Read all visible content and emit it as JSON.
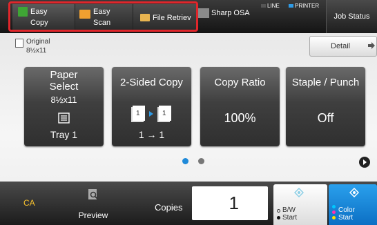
{
  "tabs": {
    "easy_copy": "Easy Copy",
    "easy_copy_l1": "Easy",
    "easy_copy_l2": "Copy",
    "easy_scan_l1": "Easy",
    "easy_scan_l2": "Scan",
    "file_retrieve": "File Retriev"
  },
  "header": {
    "sharp_osa": "Sharp OSA",
    "line_status": "LINE",
    "printer_status": "PRINTER",
    "job_status": "Job Status"
  },
  "original": {
    "label": "Original",
    "size": "8½x11"
  },
  "detail_button": "Detail",
  "cards": [
    {
      "title_l1": "Paper",
      "title_l2": "Select",
      "size": "8½x11",
      "value": "Tray 1"
    },
    {
      "title": "2-Sided Copy",
      "value": "1 → 1"
    },
    {
      "title": "Copy Ratio",
      "value": "100%"
    },
    {
      "title": "Staple / Punch",
      "value": "Off"
    }
  ],
  "pager": {
    "current_page": 1,
    "total_pages": 2
  },
  "bottom": {
    "ca": "CA",
    "preview": "Preview",
    "copies_label": "Copies",
    "copies_value": "1",
    "bw_l1": "B/W",
    "bw_l2": "Start",
    "color_l1": "Color",
    "color_l2": "Start"
  },
  "colors": {
    "accent_blue": "#1f8ad9",
    "highlight_red": "#e0262b",
    "ca_yellow": "#f7c12e",
    "easy_copy_icon": "#3fa535",
    "easy_scan_icon": "#f0a030",
    "line_indicator": "#555555",
    "printer_indicator": "#2f9be6"
  },
  "icons": {
    "easy_copy": "copy-icon",
    "easy_scan": "scan-icon",
    "file_retrieve": "folder-icon",
    "sharp_osa": "osa-icon",
    "detail": "arrow-right-icon",
    "preview": "magnifier-icon",
    "start": "diamond-icon"
  }
}
